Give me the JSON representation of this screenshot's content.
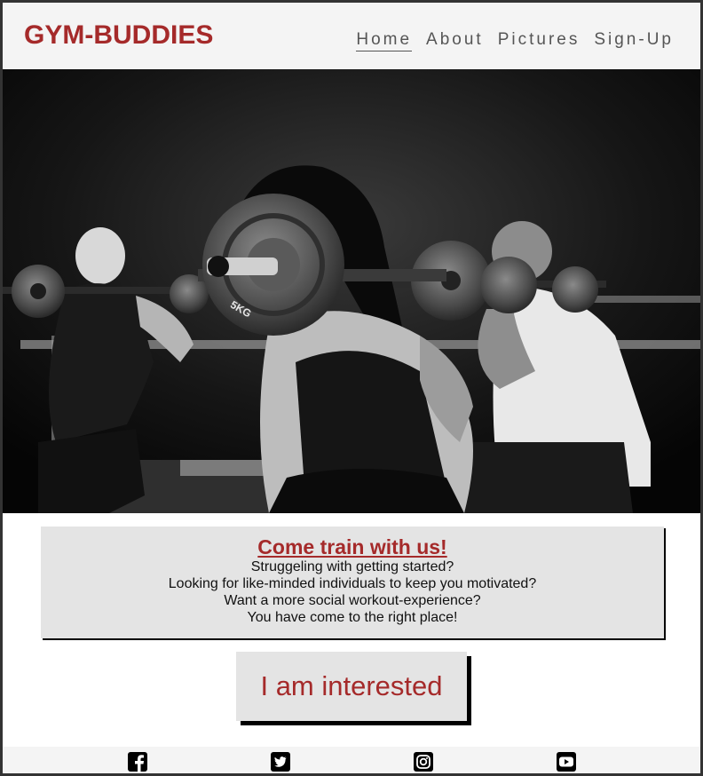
{
  "header": {
    "logo": "GYM-BUDDIES",
    "nav": [
      {
        "label": "Home",
        "active": true
      },
      {
        "label": "About",
        "active": false
      },
      {
        "label": "Pictures",
        "active": false
      },
      {
        "label": "Sign-Up",
        "active": false
      }
    ]
  },
  "hero": {
    "plate_label": "5KG"
  },
  "info": {
    "title": "Come train with us!",
    "lines": [
      "Struggeling with getting started?",
      "Looking for like-minded individuals to keep you motivated?",
      "Want a more social workout-experience?",
      "You have come to the right place!"
    ]
  },
  "cta": {
    "label": "I am interested"
  },
  "footer": {
    "icons": [
      "facebook-icon",
      "twitter-icon",
      "instagram-icon",
      "youtube-icon"
    ]
  },
  "colors": {
    "brand": "#a52a2a",
    "header_bg": "#f4f4f4",
    "box_bg": "#e4e4e4"
  }
}
